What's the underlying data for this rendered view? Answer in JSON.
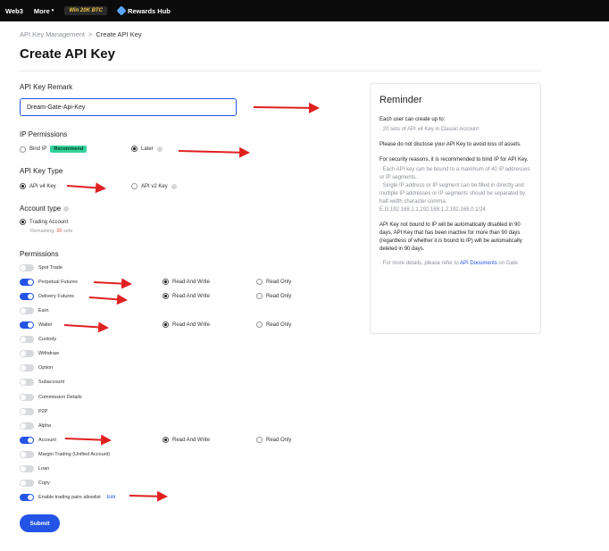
{
  "topbar": {
    "web3": "Web3",
    "more": "More",
    "promo": "Win 20K BTC",
    "rewards": "Rewards Hub"
  },
  "breadcrumb": {
    "parent": "API Key Management",
    "sep": ">",
    "current": "Create API Key"
  },
  "page_title": "Create API Key",
  "remark": {
    "label": "API Key Remark",
    "value": "Dream-Gate-Api-Key"
  },
  "ip_permissions": {
    "label": "IP Permissions",
    "bind_ip": "Bind IP",
    "recommend": "Recommend",
    "later": "Later",
    "selected": "later"
  },
  "key_type": {
    "label": "API Key Type",
    "v4": "API v4 Key",
    "v2": "API v2 Key",
    "selected": "v4"
  },
  "account_type": {
    "label": "Account type",
    "trading": "Trading Account",
    "remaining_prefix": "Remaining:",
    "remaining_count": "20",
    "remaining_suffix": "sets"
  },
  "permissions": {
    "label": "Permissions",
    "read_write": "Read And Write",
    "read_only": "Read Only",
    "edit": "Edit",
    "items": [
      {
        "name": "Spot Trade",
        "on": false,
        "mode": ""
      },
      {
        "name": "Perpetual Futures",
        "on": true,
        "mode": "rw"
      },
      {
        "name": "Delivery Futures",
        "on": true,
        "mode": "rw"
      },
      {
        "name": "Earn",
        "on": false,
        "mode": ""
      },
      {
        "name": "Wallet",
        "on": true,
        "mode": "rw"
      },
      {
        "name": "Custody",
        "on": false,
        "mode": ""
      },
      {
        "name": "Withdraw",
        "on": false,
        "mode": ""
      },
      {
        "name": "Option",
        "on": false,
        "mode": ""
      },
      {
        "name": "Subaccount",
        "on": false,
        "mode": ""
      },
      {
        "name": "Commission Details",
        "on": false,
        "mode": ""
      },
      {
        "name": "P2P",
        "on": false,
        "mode": ""
      },
      {
        "name": "Alpha",
        "on": false,
        "mode": ""
      },
      {
        "name": "Account",
        "on": true,
        "mode": "rw"
      },
      {
        "name": "Margin Trading (Unified Account)",
        "on": false,
        "mode": ""
      },
      {
        "name": "Loan",
        "on": false,
        "mode": ""
      },
      {
        "name": "Copy",
        "on": false,
        "mode": ""
      },
      {
        "name": "Enable trading pairs allowlist",
        "on": true,
        "mode": ""
      }
    ]
  },
  "submit": "Submit",
  "reminder": {
    "title": "Reminder",
    "p1": "Each user can create up to:",
    "p1_sub": "· 20 sets of API v4 Key in Classic Account",
    "p2": "Please do not disclose your API Key to avoid loss of assets.",
    "p3": "For security reasons, it is recommended to bind IP for API Key.",
    "p3_sub1": "· Each API key can be bound to a maximum of 40 IP addresses or IP segments.",
    "p3_sub2": "· Single IP address or IP segment can be filled in directly and multiple IP addresses or IP segments should be separated by half-width character comma. E.G.192.168.1.1,192.168.1.2,192.168.0.1/24",
    "p4": "API Key not bound to IP will be automatically disabled in 90 days, API Key that has been inactive for more than 90 days (regardless of whether it is bound to IP) will be automatically deleted in 90 days.",
    "p5_prefix": "· For more details, please refer to",
    "p5_link": "API Documents",
    "p5_suffix": "on Gate."
  },
  "colors": {
    "accent": "#2354e6",
    "annotation_arrow": "#e02020",
    "recommend": "#34d399"
  }
}
